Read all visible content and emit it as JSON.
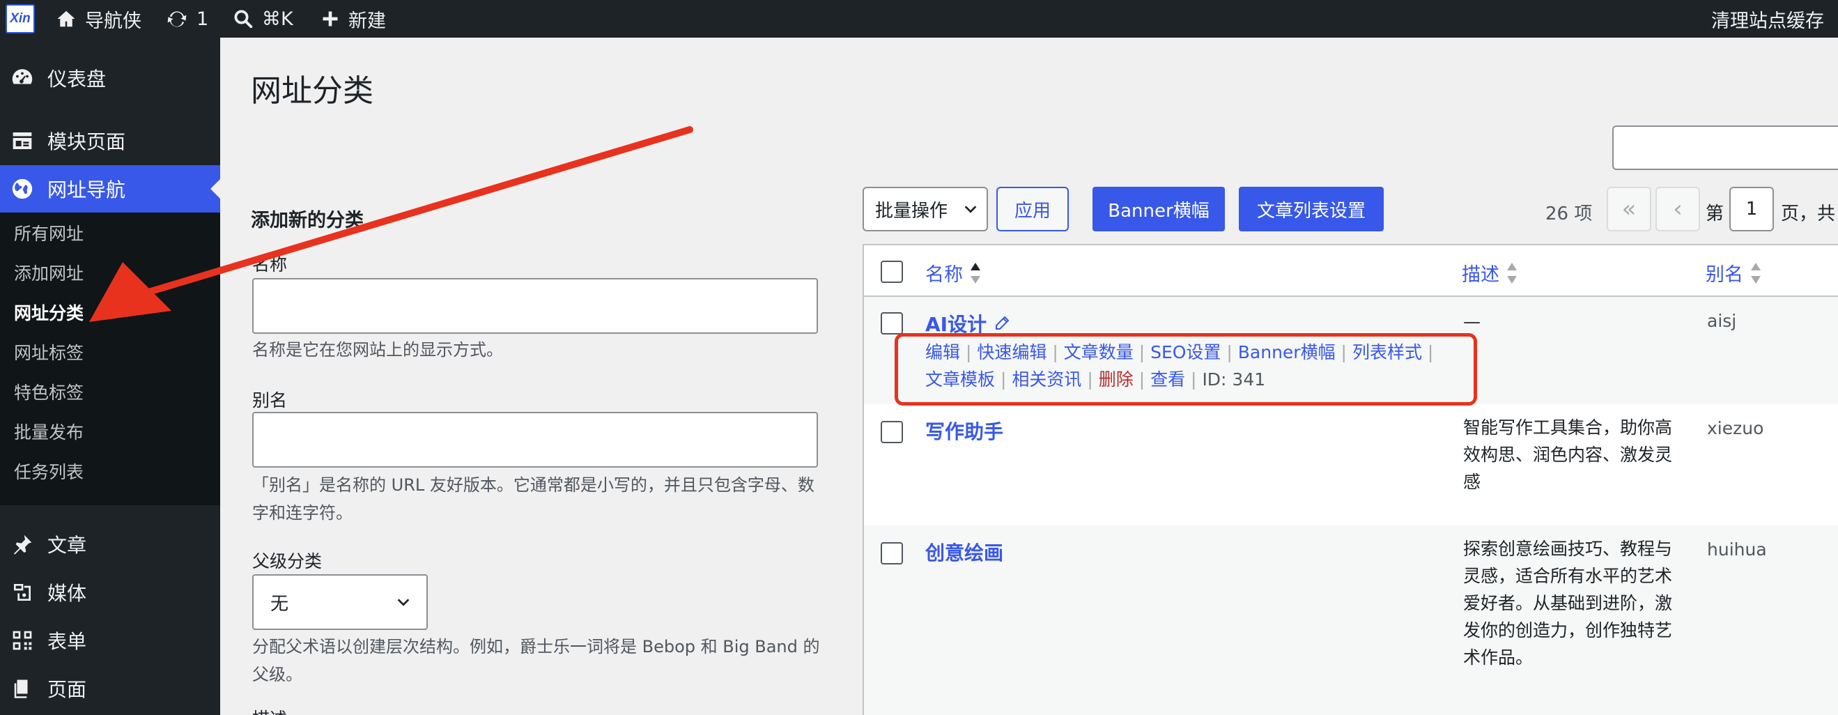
{
  "adminbar": {
    "logo_text": "Xin",
    "site_name": "导航侠",
    "updates_count": "1",
    "search_shortcut": "⌘K",
    "new_label": "新建",
    "clear_cache": "清理站点缓存"
  },
  "sidebar": {
    "items": [
      {
        "label": "仪表盘",
        "icon": "dashboard-icon"
      },
      {
        "label": "模块页面",
        "icon": "layout-icon"
      },
      {
        "label": "网址导航",
        "icon": "globe-icon"
      },
      {
        "label": "文章",
        "icon": "pin-icon"
      },
      {
        "label": "媒体",
        "icon": "media-icon"
      },
      {
        "label": "表单",
        "icon": "form-icon"
      },
      {
        "label": "页面",
        "icon": "page-icon"
      }
    ],
    "submenu": [
      "所有网址",
      "添加网址",
      "网址分类",
      "网址标签",
      "特色标签",
      "批量发布",
      "任务列表"
    ]
  },
  "page": {
    "title": "网址分类"
  },
  "form": {
    "heading": "添加新的分类",
    "name_label": "名称",
    "name_hint": "名称是它在您网站上的显示方式。",
    "slug_label": "别名",
    "slug_hint": "「别名」是名称的 URL 友好版本。它通常都是小写的，并且只包含字母、数字和连字符。",
    "parent_label": "父级分类",
    "parent_value": "无",
    "parent_hint": "分配父术语以创建层次结构。例如，爵士乐一词将是 Bebop 和 Big Band 的父级。",
    "desc_label": "描述"
  },
  "toolbar": {
    "bulk_label": "批量操作",
    "apply_label": "应用",
    "banner_label": "Banner横幅",
    "article_list_label": "文章列表设置",
    "count": "26 项",
    "first_page": "«",
    "prev_page": "‹",
    "page_prefix": "第",
    "current_page": "1",
    "page_suffix": "页，共"
  },
  "table": {
    "columns": {
      "name": "名称",
      "description": "描述",
      "slug": "别名"
    },
    "rows": [
      {
        "name": "AI设计",
        "description": "—",
        "slug": "aisj",
        "actions_line1": [
          "编辑",
          "快速编辑",
          "文章数量",
          "SEO设置",
          "Banner横幅",
          "列表样式"
        ],
        "actions_line2": [
          "文章模板",
          "相关资讯",
          "删除",
          "查看"
        ],
        "id_text": "ID: 341"
      },
      {
        "name": "写作助手",
        "description": "智能写作工具集合，助你高效构思、润色内容、激发灵感",
        "slug": "xiezuo"
      },
      {
        "name": "创意绘画",
        "description": "探索创意绘画技巧、教程与灵感，适合所有水平的艺术爱好者。从基础到进阶，激发你的创造力，创作独特艺术作品。",
        "slug": "huihua"
      }
    ]
  },
  "colors": {
    "admin_dark": "#1d2327",
    "accent": "#3858e9",
    "annotation": "#e8321e",
    "delete": "#b32d2e"
  }
}
